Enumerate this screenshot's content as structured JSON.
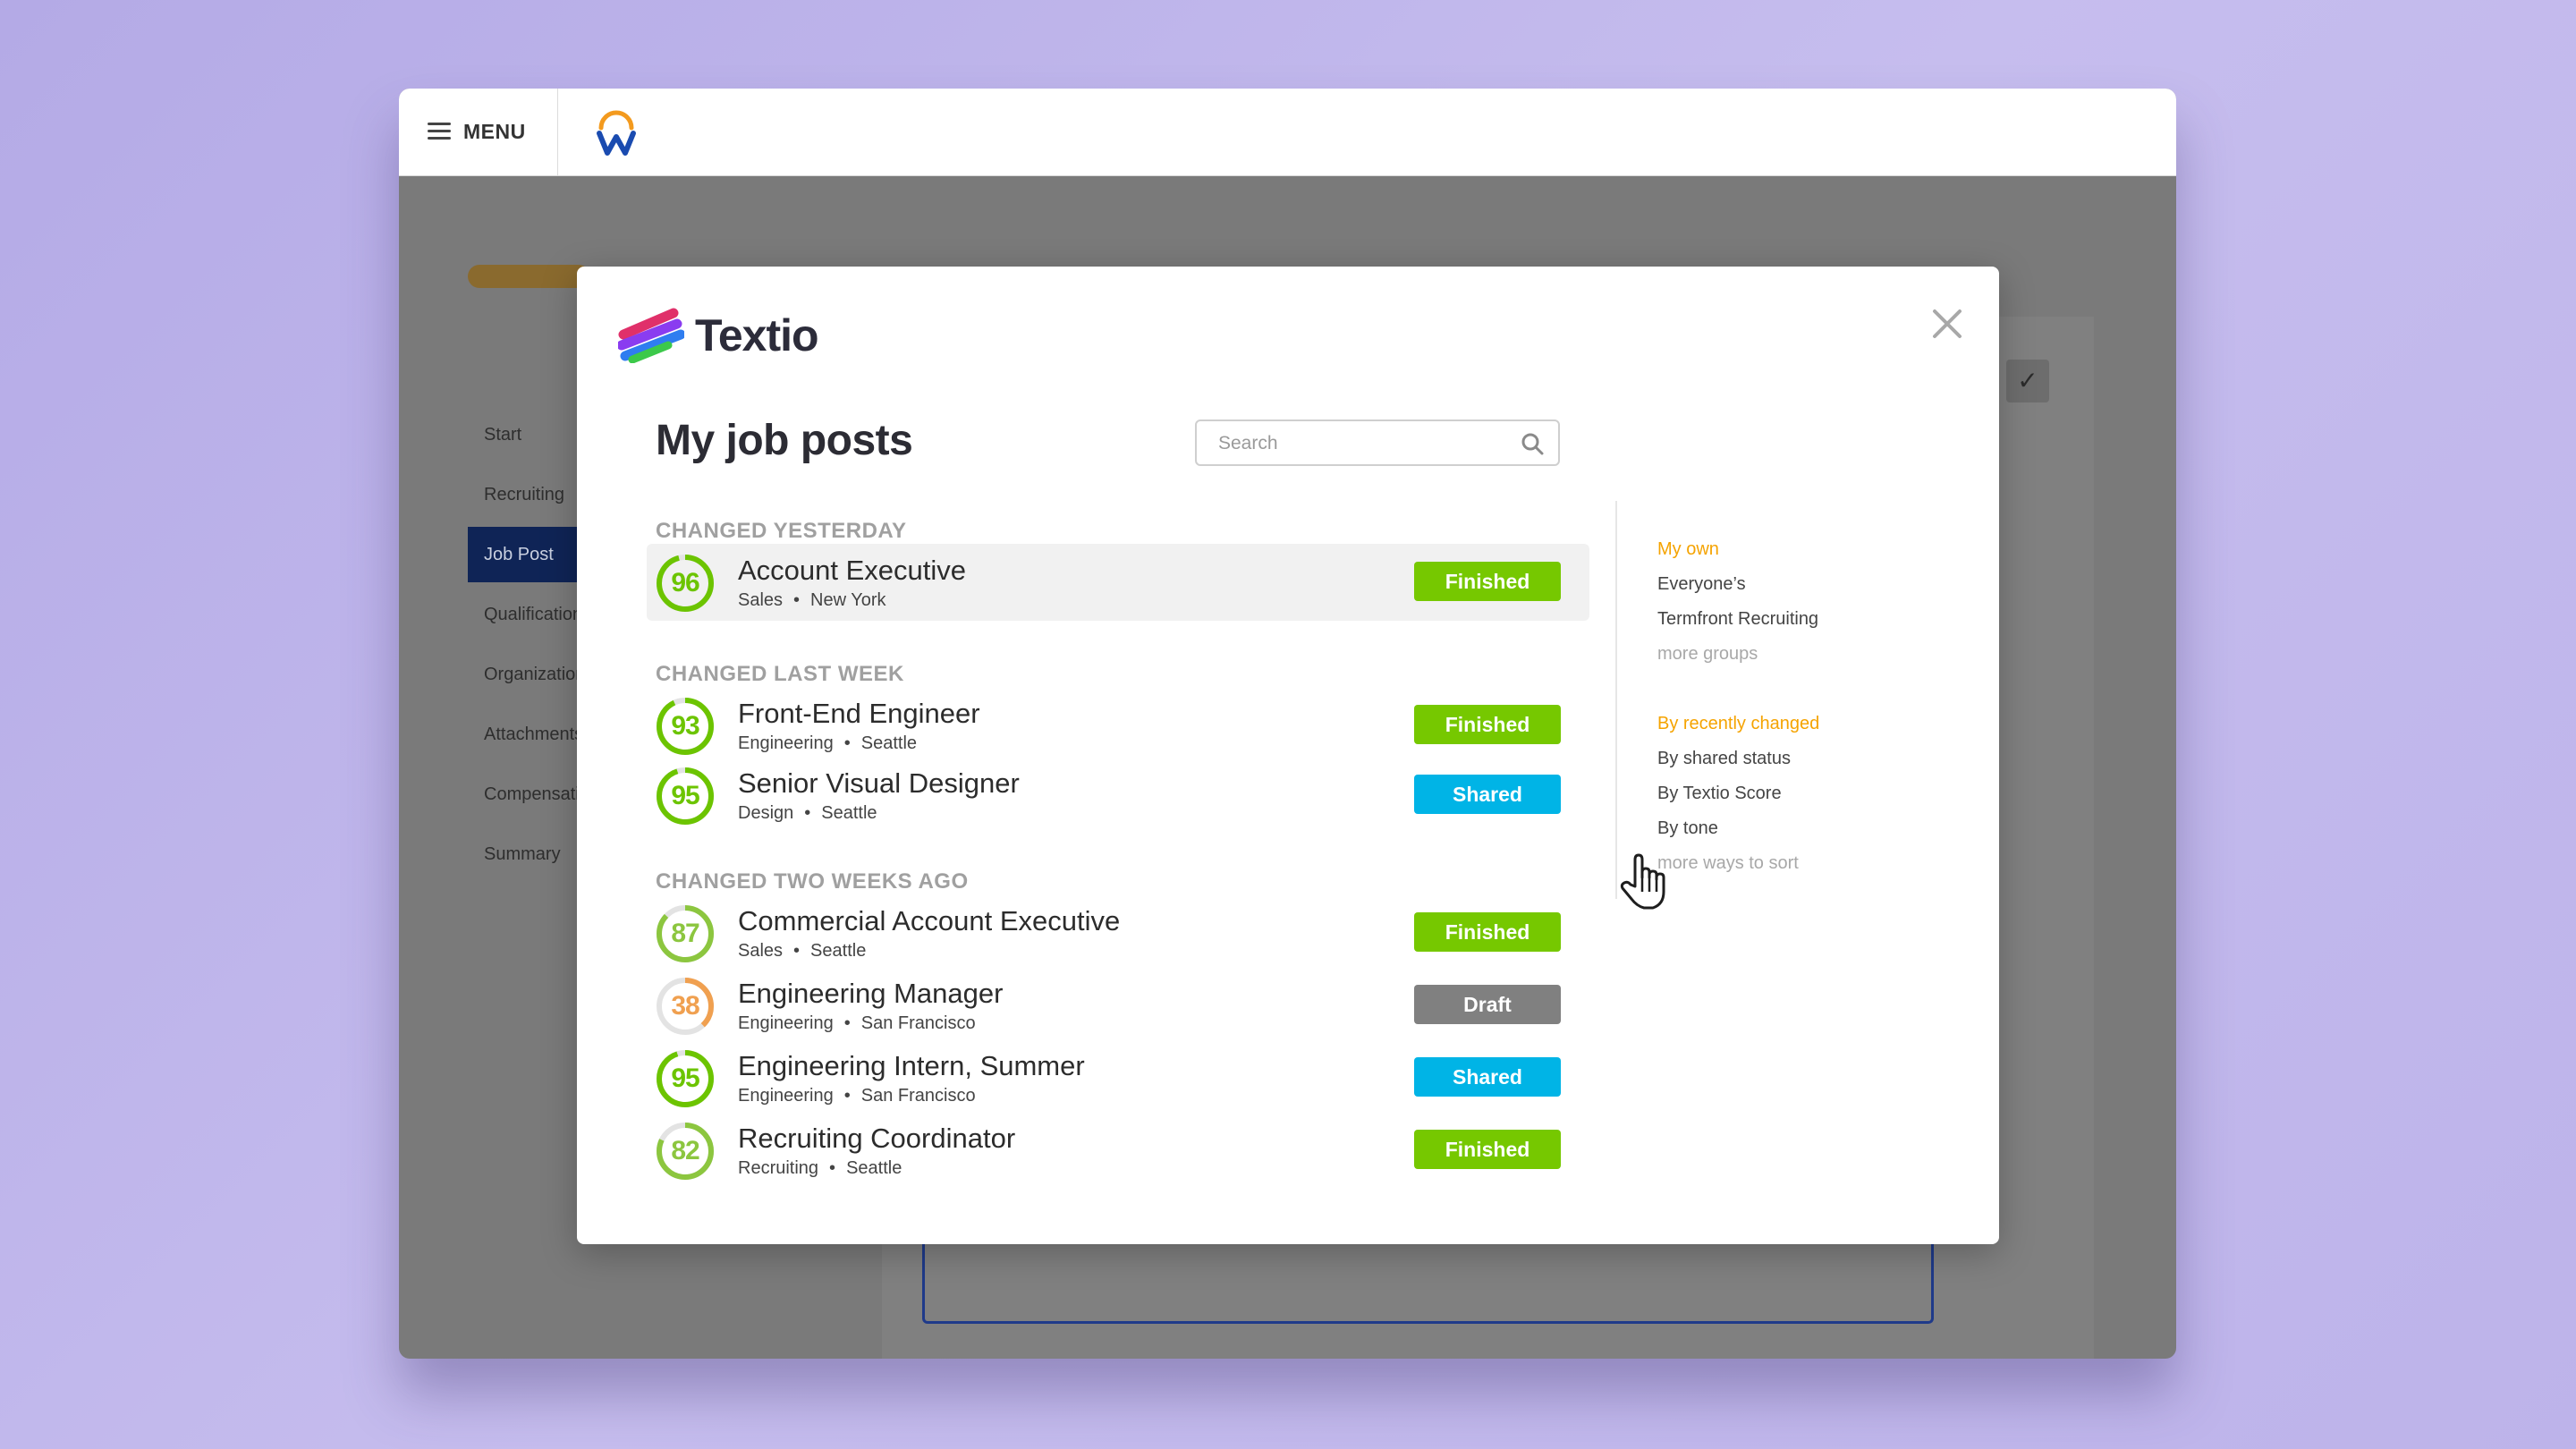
{
  "app": {
    "menu_label": "MENU",
    "progress_fraction": 0.12,
    "side_nav": [
      "Start",
      "Recruiting",
      "Job Post",
      "Qualifications",
      "Organizations",
      "Attachments",
      "Compensation",
      "Summary"
    ],
    "active_nav": "Job Post"
  },
  "modal": {
    "brand": "Textio",
    "title": "My job posts",
    "search_placeholder": "Search",
    "groups": [
      {
        "heading": "CHANGED YESTERDAY",
        "posts": [
          {
            "score": "96",
            "title": "Account Executive",
            "department": "Sales",
            "location": "New York",
            "status": "Finished"
          }
        ]
      },
      {
        "heading": "CHANGED LAST WEEK",
        "posts": [
          {
            "score": "93",
            "title": "Front-End Engineer",
            "department": "Engineering",
            "location": "Seattle",
            "status": "Finished"
          },
          {
            "score": "95",
            "title": "Senior Visual Designer",
            "department": "Design",
            "location": "Seattle",
            "status": "Shared"
          }
        ]
      },
      {
        "heading": "CHANGED TWO WEEKS AGO",
        "posts": [
          {
            "score": "87",
            "title": "Commercial Account Executive",
            "department": "Sales",
            "location": "Seattle",
            "status": "Finished"
          },
          {
            "score": "38",
            "title": "Engineering Manager",
            "department": "Engineering",
            "location": "San Francisco",
            "status": "Draft"
          },
          {
            "score": "95",
            "title": "Engineering Intern, Summer",
            "department": "Engineering",
            "location": "San Francisco",
            "status": "Shared"
          },
          {
            "score": "82",
            "title": "Recruiting Coordinator",
            "department": "Recruiting",
            "location": "Seattle",
            "status": "Finished"
          }
        ]
      }
    ],
    "dot_separator": "•",
    "filters": {
      "ownership": [
        "My own",
        "Everyone’s",
        "Termfront Recruiting"
      ],
      "more_groups": "more groups",
      "sorts": [
        "By recently changed",
        "By shared status",
        "By Textio Score",
        "By tone"
      ],
      "more_sorts": "more ways to sort"
    }
  },
  "colors": {
    "finished": "#76c800",
    "shared": "#00b4e6",
    "draft": "#808080",
    "score_high": "#6cc400",
    "score_mid": "#8cc63f",
    "score_low": "#f0a050",
    "active_filter": "#f5a300",
    "workday_blue": "#0f2456"
  }
}
